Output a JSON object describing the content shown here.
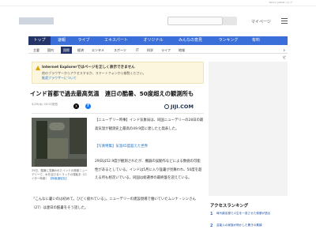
{
  "topbar": {
    "links": "Yahoo! JAPAN  ヘルプ"
  },
  "header": {
    "mypage_label": "マイページ"
  },
  "main_nav": [
    {
      "label": "トップ",
      "active": true
    },
    {
      "label": "速報",
      "active": false
    },
    {
      "label": "ライブ",
      "active": false
    },
    {
      "label": "エキスパート",
      "active": false
    },
    {
      "label": "オリジナル",
      "active": false
    },
    {
      "label": "みんなの意見",
      "active": false
    },
    {
      "label": "ランキング",
      "active": false
    },
    {
      "label": "有料",
      "active": false
    }
  ],
  "sub_nav": [
    {
      "label": "主要",
      "active": false
    },
    {
      "label": "国内",
      "active": false
    },
    {
      "label": "国際",
      "active": true
    },
    {
      "label": "経済",
      "active": false
    },
    {
      "label": "エンタメ",
      "active": false
    },
    {
      "label": "スポーツ",
      "active": false
    },
    {
      "label": "IT",
      "active": false
    },
    {
      "label": "科学",
      "active": false
    },
    {
      "label": "ライフ",
      "active": false
    },
    {
      "label": "地域",
      "active": false
    }
  ],
  "topics_button": "トピックス一覧",
  "ie_banner": {
    "title": "Internet Explorerではページを正しく表示できません",
    "body": "他のブラウザーからアクセスするか、スマートフォンから御覧ください。",
    "link": "推奨ブラウザーについて"
  },
  "article": {
    "headline": "インド首都で過去最高気温　連日の酷暑、50度超えの観測所も",
    "meta": "5/29(水) 20:52配信",
    "sponsor": "JIJI.COM",
    "photo_caption": "29日、酷暑に見舞われたインドの首都ニューデリーで、水を浴びるトラックの運転手（ロイター時事）",
    "photo_caption_more": "【時事通信社】",
    "paragraphs": [
      "【ニューデリー時事】インド気象局は、同国ニューデリーの28日の最高気温が観測史上最高の49.9度に達したと発表した。",
      "【写真特集】気温45度超えた世界",
      "29日は52.9度が観測されたが、機器の誤動作などによる数値の可能性があるとしている。インドは5月に入り猛暑が見舞われ、50度を超える所も相次いでいる。同国は総選挙の最終盤を迎えている。",
      "「こんなに暑いのは初めて。ひどく疲れている」。ニューデリーの建設現場で働いていたムンナ・シンさん（27）は連日の酷暑をそう話した。"
    ]
  },
  "ranking": {
    "title": "アクセスランキング",
    "items": [
      {
        "rank": "1",
        "text": "時代劇名優で人生を一変させた俳優が語る"
      },
      {
        "rank": "2",
        "text": "芸能人の家族が明かした驚きの素顔"
      }
    ]
  }
}
